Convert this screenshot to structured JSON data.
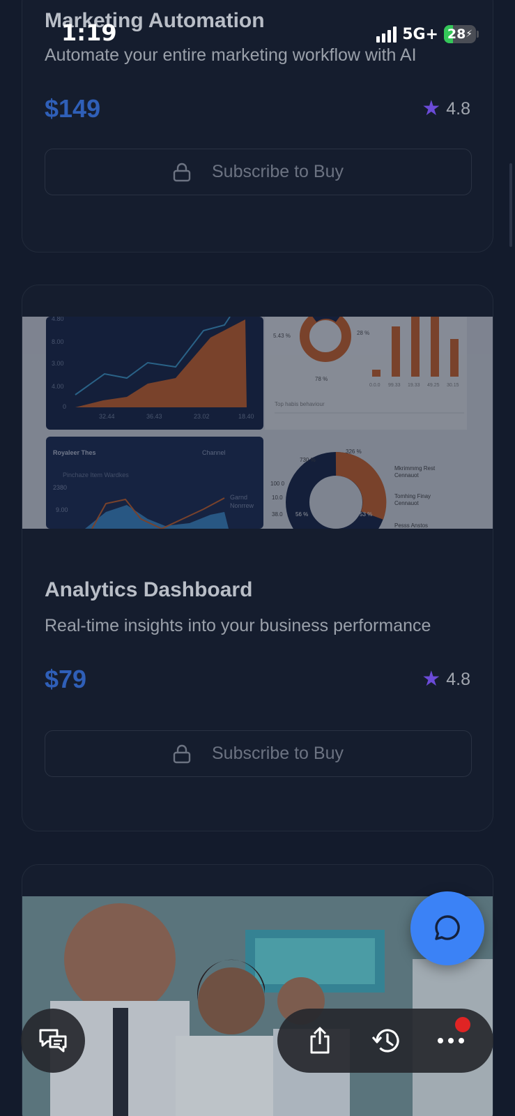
{
  "status_bar": {
    "time": "1:19",
    "network": "5G+",
    "battery": "28",
    "battery_level": 0.28
  },
  "products": [
    {
      "title": "Marketing Automation",
      "description": "Automate your entire marketing workflow with AI",
      "price": "$149",
      "rating": "4.8",
      "button_label": "Subscribe to Buy"
    },
    {
      "title": "Analytics Dashboard",
      "description": "Real-time insights into your business performance",
      "price": "$79",
      "rating": "4.8",
      "button_label": "Subscribe to Buy",
      "image_labels": {
        "y_ticks": [
          "4.80",
          "8.00",
          "3.00",
          "4.00",
          "0"
        ],
        "x_ticks": [
          "32.44",
          "36.43",
          "23.02",
          "18.40"
        ],
        "donut_top_left": "5.43 %",
        "donut_top_right": "28 %",
        "donut_top_bottom": "78 %",
        "bar_ticks": [
          "0.0.0",
          "99.33",
          "19.33",
          "49.25",
          "30.15"
        ],
        "panel_caption": "Top habis behaviour",
        "panel2_title": "Royaleer Thes",
        "panel2_button": "Channel",
        "panel2_sub": "Pinchaze Item Wardkes",
        "panel2_y": [
          "2380",
          "9.00"
        ],
        "panel2_legend": [
          "Garnd",
          "Nonrrew"
        ],
        "donut2_top": "326 %",
        "donut2_left": "730 %",
        "donut2_ticks": [
          "100 0",
          "10.0",
          "38.0"
        ],
        "donut2_inner_left": "56 %",
        "donut2_inner_right": "53 %",
        "donut2_legend": [
          "Mkrimmmg Rest",
          "Cennauot",
          "Tomhing Finay",
          "Cennauot",
          "Pesss Anstos"
        ]
      }
    },
    {
      "image": "customer-service-team"
    }
  ],
  "icons": {
    "lock": "lock-icon",
    "star": "star-icon",
    "chat": "chat-bubble-icon",
    "messages": "messages-icon",
    "share": "share-icon",
    "history": "history-icon",
    "more": "more-icon"
  },
  "colors": {
    "background": "#131b2c",
    "price": "#2f5fb8",
    "star": "#6b4bd8",
    "fab": "#3b82f6",
    "notification": "#e02424"
  }
}
